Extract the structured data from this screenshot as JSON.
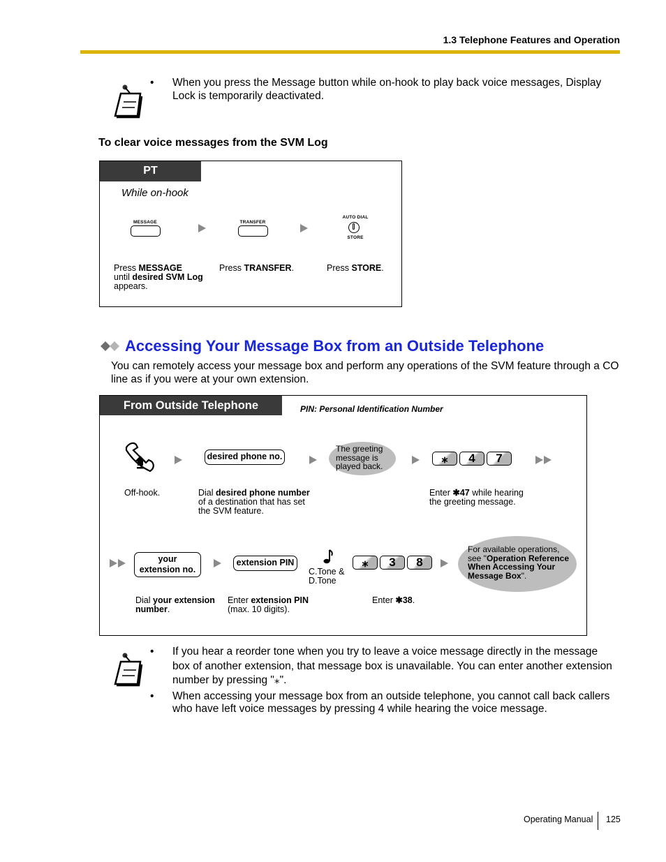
{
  "header": {
    "section_title": "1.3 Telephone Features and Operation",
    "rule_color": "#dcb400"
  },
  "note1": {
    "icon": "note-pad-icon",
    "bullets": [
      "When you press the Message button while on-hook to play back voice messages, Display Lock is temporarily deactivated."
    ]
  },
  "clear_log": {
    "heading": "To clear voice messages from the SVM Log",
    "tab_label": "PT",
    "condition": "While on-hook",
    "buttons": {
      "message": "MESSAGE",
      "transfer": "TRANSFER",
      "auto_dial": "AUTO DIAL",
      "store": "STORE"
    },
    "steps": [
      {
        "pre": "Press ",
        "bold": "MESSAGE",
        "mid": " until ",
        "bold2": "desired SVM Log",
        "post": " appears."
      },
      {
        "pre": "Press ",
        "bold": "TRANSFER",
        "post": "."
      },
      {
        "pre": "Press ",
        "bold": "STORE",
        "post": "."
      }
    ]
  },
  "section": {
    "title": "Accessing Your Message Box from an Outside Telephone",
    "title_color": "#1a27d8",
    "intro": "You can remotely access your message box and perform any operations of the SVM feature through a CO line as if you were at your own extension."
  },
  "outside": {
    "tab_label": "From Outside Telephone",
    "pin_note": "PIN: Personal Identification Number",
    "row1": {
      "desired_phone": "desired phone no.",
      "greeting_bubble": "The greeting message is played back.",
      "keys": [
        "⁎",
        "4",
        "7"
      ],
      "cap_offhook": "Off-hook.",
      "cap_dial_pre": "Dial ",
      "cap_dial_bold": "desired phone number",
      "cap_dial_post": " of a destination that has set the SVM feature.",
      "cap_enter_pre": "Enter ",
      "cap_enter_bold": "✱47",
      "cap_enter_post": " while hearing the greeting message."
    },
    "row2": {
      "your_ext_line1": "your",
      "your_ext_line2": "extension no.",
      "ext_pin": "extension PIN",
      "tone_label_1": "C.Tone &",
      "tone_label_2": "D.Tone",
      "keys": [
        "⁎",
        "3",
        "8"
      ],
      "ops_pre": "For available operations, see \"",
      "ops_bold": "Operation Reference When Accessing Your Message Box",
      "ops_post": "\".",
      "cap_dial_pre": "Dial ",
      "cap_dial_bold": "your extension number",
      "cap_dial_post": ".",
      "cap_pin_pre": "Enter ",
      "cap_pin_bold": "extension PIN",
      "cap_pin_post": " (max. 10 digits).",
      "cap_enter_pre": "Enter ",
      "cap_enter_bold": "✱38",
      "cap_enter_post": "."
    }
  },
  "note2": {
    "icon": "note-pad-icon",
    "bullets": [
      "If you hear a reorder tone when you try to leave a voice message directly in the message box of another extension, that message box is unavailable. You can enter another extension number by pressing \"⁎\".",
      "When accessing your message box from an outside telephone, you cannot call back callers who have left voice messages by pressing 4 while hearing the voice message."
    ]
  },
  "footer": {
    "label": "Operating Manual",
    "page": "125"
  }
}
